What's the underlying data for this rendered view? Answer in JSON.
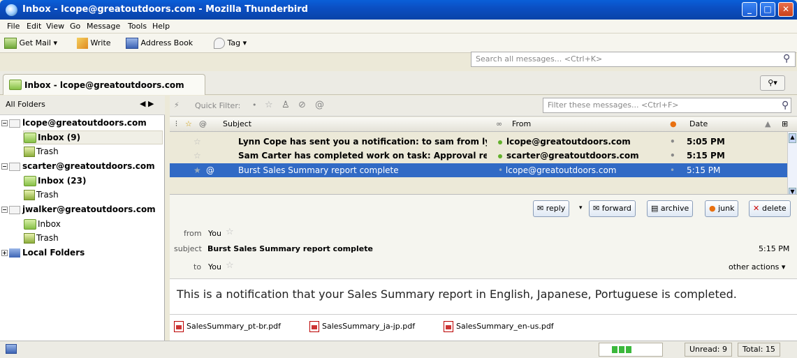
{
  "window": {
    "title": "Inbox - lcope@greatoutdoors.com - Mozilla Thunderbird",
    "min": "_",
    "max": "□",
    "close": "✕"
  },
  "menu": [
    "File",
    "Edit",
    "View",
    "Go",
    "Message",
    "Tools",
    "Help"
  ],
  "toolbar": {
    "get_mail": "Get Mail",
    "write": "Write",
    "address_book": "Address Book",
    "tag": "Tag",
    "search_placeholder": "Search all messages... <Ctrl+K>"
  },
  "tab": {
    "label": "Inbox - lcope@greatoutdoors.com"
  },
  "folders": {
    "header": "All Folders",
    "items": [
      {
        "label": "lcope@greatoutdoors.com"
      },
      {
        "label": "Inbox (9)"
      },
      {
        "label": "Trash"
      },
      {
        "label": "scarter@greatoutdoors.com"
      },
      {
        "label": "Inbox (23)"
      },
      {
        "label": "Trash"
      },
      {
        "label": "jwalker@greatoutdoors.com"
      },
      {
        "label": "Inbox"
      },
      {
        "label": "Trash"
      },
      {
        "label": "Local Folders"
      }
    ]
  },
  "filter": {
    "label": "Quick Filter:",
    "placeholder": "Filter these messages... <Ctrl+F>"
  },
  "columns": {
    "subject": "Subject",
    "from": "From",
    "date": "Date"
  },
  "messages": [
    {
      "subject": "Lynn Cope has sent you a notification: to sam from lynn",
      "from": "lcope@greatoutdoors.com",
      "date": "5:05 PM"
    },
    {
      "subject": "Sam Carter has completed work on task: Approval re...",
      "from": "scarter@greatoutdoors.com",
      "date": "5:15 PM"
    },
    {
      "subject": "Burst Sales Summary report complete",
      "from": "lcope@greatoutdoors.com",
      "date": "5:15 PM"
    }
  ],
  "message": {
    "from_label": "from",
    "from": "You",
    "subject_label": "subject",
    "subject": "Burst Sales Summary report complete",
    "time": "5:15 PM",
    "to_label": "to",
    "to": "You",
    "other_actions": "other actions",
    "buttons": {
      "reply": "reply",
      "forward": "forward",
      "archive": "archive",
      "junk": "junk",
      "delete": "delete"
    },
    "body": "This is a notification that your Sales Summary report in English, Japanese, Portuguese is completed.",
    "attachments": [
      "SalesSummary_pt-br.pdf",
      "SalesSummary_ja-jp.pdf",
      "SalesSummary_en-us.pdf"
    ]
  },
  "status": {
    "unread": "Unread: 9",
    "total": "Total: 15"
  }
}
